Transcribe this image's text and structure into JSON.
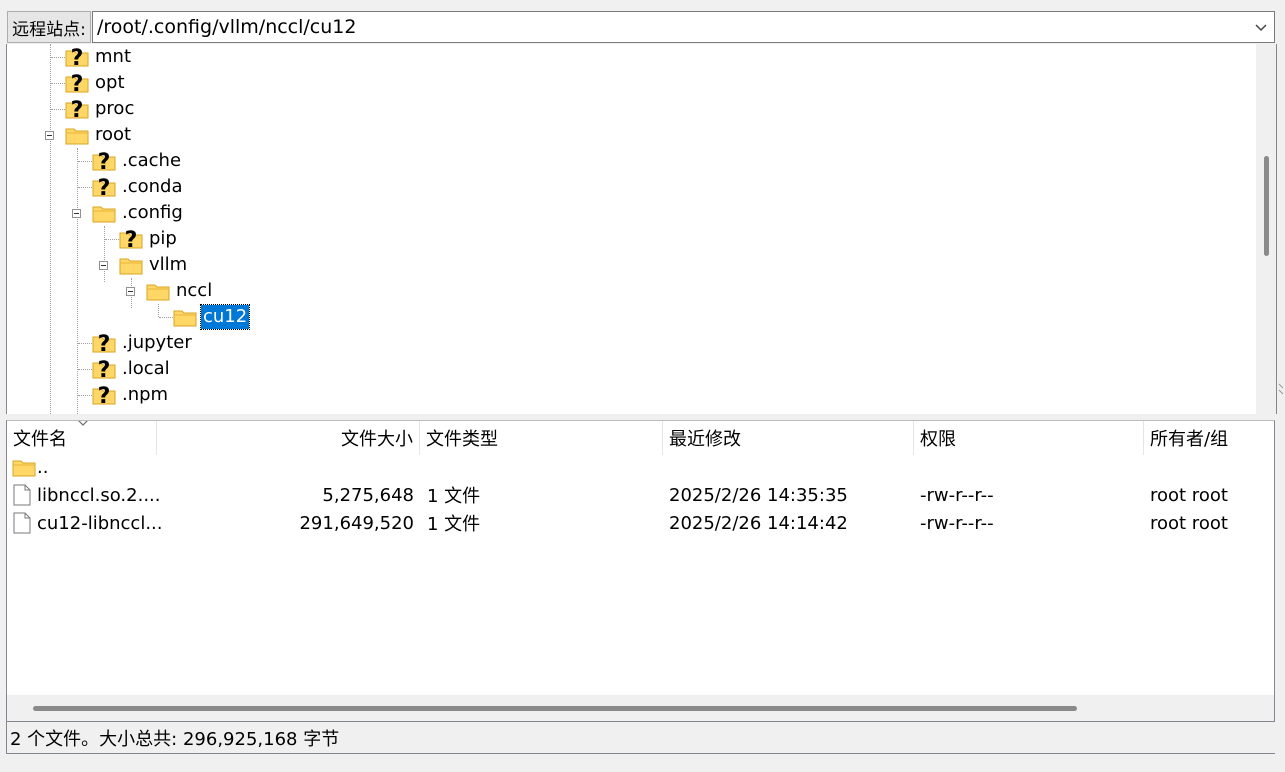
{
  "address_bar": {
    "label": "远程站点:",
    "path": "/root/.config/vllm/nccl/cu12"
  },
  "tree": {
    "nodes": [
      {
        "label": "mnt",
        "icon": "question-folder-icon"
      },
      {
        "label": "opt",
        "icon": "question-folder-icon"
      },
      {
        "label": "proc",
        "icon": "question-folder-icon"
      },
      {
        "label": "root",
        "icon": "folder-icon",
        "expanded": true
      },
      {
        "label": ".cache",
        "icon": "question-folder-icon"
      },
      {
        "label": ".conda",
        "icon": "question-folder-icon"
      },
      {
        "label": ".config",
        "icon": "folder-icon",
        "expanded": true
      },
      {
        "label": "pip",
        "icon": "question-folder-icon"
      },
      {
        "label": "vllm",
        "icon": "folder-icon",
        "expanded": true
      },
      {
        "label": "nccl",
        "icon": "folder-icon",
        "expanded": true
      },
      {
        "label": "cu12",
        "icon": "folder-icon",
        "selected": true
      },
      {
        "label": ".jupyter",
        "icon": "question-folder-icon"
      },
      {
        "label": ".local",
        "icon": "question-folder-icon"
      },
      {
        "label": ".npm",
        "icon": "question-folder-icon"
      }
    ]
  },
  "file_list": {
    "columns": [
      "文件名",
      "文件大小",
      "文件类型",
      "最近修改",
      "权限",
      "所有者/组"
    ],
    "parent_dir": "..",
    "rows": [
      {
        "name": "libnccl.so.2....",
        "size": "5,275,648",
        "type": "1 文件",
        "modified": "2025/2/26 14:35:35",
        "perms": "-rw-r--r--",
        "owner": "root root"
      },
      {
        "name": "cu12-libnccl...",
        "size": "291,649,520",
        "type": "1 文件",
        "modified": "2025/2/26 14:14:42",
        "perms": "-rw-r--r--",
        "owner": "root root"
      }
    ]
  },
  "status": {
    "text": "2 个文件。大小总共: 296,925,168 字节"
  },
  "colors": {
    "selection": "#0078d7",
    "folder_fill": "#ffd766",
    "folder_edge": "#d9a521"
  }
}
